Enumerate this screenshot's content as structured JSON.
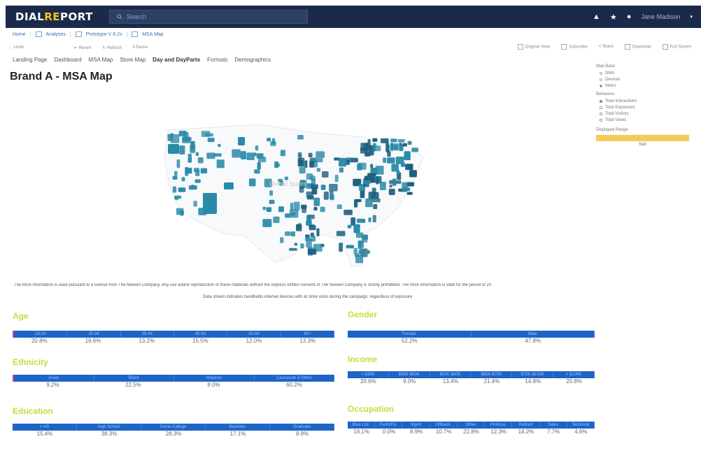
{
  "app": {
    "logo_a": "DIAL",
    "logo_b": "RE",
    "logo_c": "PORT",
    "search_placeholder": "Search",
    "user_name": "Jane Madison"
  },
  "breadcrumb": {
    "home": "Home",
    "folder": "Analyses",
    "project": "Prototype V 8.2x",
    "current": "MSA Map"
  },
  "toolbar": {
    "undo": "Undo",
    "revert": "Revert",
    "refresh": "Refresh",
    "pause": "Pause",
    "original_view": "Original View",
    "subscribe": "Subscribe",
    "share": "Share",
    "download": "Download",
    "full_screen": "Full Screen"
  },
  "tabs": [
    "Landing Page",
    "Dashboard",
    "MSA Map",
    "Store Map",
    "Day and DayParts",
    "Formats",
    "Demographics"
  ],
  "page_title": "Brand A - MSA Map",
  "sidebar": {
    "map_base_label": "Map Base",
    "map_base_options": [
      {
        "label": "DMA",
        "selected": false
      },
      {
        "label": "Devices",
        "selected": false
      },
      {
        "label": "Metro",
        "selected": true
      }
    ],
    "behaviors_label": "Behaviors",
    "behavior_options": [
      {
        "label": "Total Interactions",
        "checked": true
      },
      {
        "label": "Total Exposures",
        "checked": false
      },
      {
        "label": "Total Visitors",
        "checked": false
      },
      {
        "label": "Total Views",
        "checked": false
      }
    ],
    "displayed_range_label": "Displayed Range",
    "range_value": "Null",
    "range_color": "#f2cd56"
  },
  "map": {
    "label": "United States",
    "region_color": "#2a8aa8",
    "dense_color": "#1d5f7e"
  },
  "disclaimer": "The MSA information is used pursuant to a license from The Nielsen Company. Any use and/or reproduction of these materials without the express written consent of The Nielsen Company is strictly prohibited. The MSA information is valid for the period of 20",
  "disclaimer2": "Data shown indicates handhelds internet devices with at store visits during the campaign, regardless of exposure",
  "colors": {
    "section_title": "#c8da3a",
    "table_header": "#1e64c8",
    "topbar": "#1b2a4a"
  },
  "sections": {
    "age": {
      "title": "Age",
      "headers": [
        "18-24",
        "25-34",
        "35-44",
        "45-54",
        "55-64",
        "65+"
      ],
      "values": [
        "20.8%",
        "16.6%",
        "13.2%",
        "15.5%",
        "12.0%",
        "13.3%"
      ]
    },
    "gender": {
      "title": "Gender",
      "headers": [
        "Female",
        "Male"
      ],
      "values": [
        "52.2%",
        "47.8%"
      ]
    },
    "ethnicity": {
      "title": "Ethnicity",
      "headers": [
        "Asian",
        "Black",
        "Hispanic",
        "Caucasian & Other"
      ],
      "values": [
        "9.2%",
        "22.5%",
        "8.0%",
        "60.2%"
      ]
    },
    "income": {
      "title": "Income",
      "headers": [
        "< $35K",
        "$35K-$50K",
        "$50K-$60K",
        "$60K-$75K",
        "$75K-$100K",
        "> $100K"
      ],
      "values": [
        "20.6%",
        "9.0%",
        "13.4%",
        "21.4%",
        "14.8%",
        "20.8%"
      ]
    },
    "education": {
      "title": "Education",
      "headers": [
        "< HS",
        "High School",
        "Some College",
        "Bachelor",
        "Graduate"
      ],
      "values": [
        "15.4%",
        "38.3%",
        "28.3%",
        "17.1%",
        "8.9%"
      ]
    },
    "occupation": {
      "title": "Occupation",
      "headers": [
        "Blue Col.",
        "Farm/Fis.",
        "Mgmt",
        "Office/A.",
        "Other",
        "Professi.",
        "Retired",
        "Sales",
        "Technical"
      ],
      "values": [
        "18.1%",
        "0.0%",
        "8.9%",
        "10.7%",
        "22.8%",
        "12.3%",
        "14.2%",
        "7.7%",
        "4.6%"
      ]
    }
  }
}
